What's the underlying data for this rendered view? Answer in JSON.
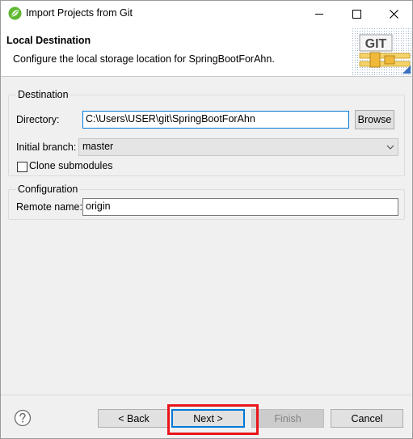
{
  "window": {
    "title": "Import Projects from Git",
    "icon": "spring-leaf-icon"
  },
  "header": {
    "title": "Local Destination",
    "description": "Configure the local storage location for SpringBootForAhn.",
    "logo_text": "GIT"
  },
  "destination": {
    "group_title": "Destination",
    "directory_label": "Directory:",
    "directory_value": "C:\\Users\\USER\\git\\SpringBootForAhn",
    "browse_label": "Browse",
    "initial_branch_label": "Initial branch:",
    "initial_branch_value": "master",
    "clone_submodules_label": "Clone submodules",
    "clone_submodules_checked": false
  },
  "configuration": {
    "group_title": "Configuration",
    "remote_name_label": "Remote name:",
    "remote_name_value": "origin"
  },
  "footer": {
    "help_icon": "question-mark-icon",
    "back_label": "< Back",
    "next_label": "Next >",
    "finish_label": "Finish",
    "cancel_label": "Cancel"
  },
  "colors": {
    "highlight": "#e8151b",
    "focus": "#0078d7"
  }
}
